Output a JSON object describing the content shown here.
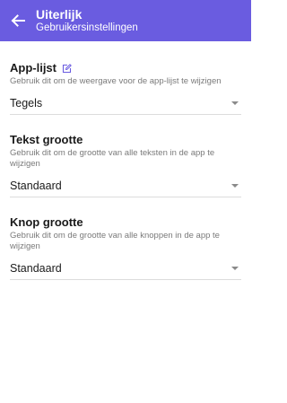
{
  "header": {
    "title": "Uiterlijk",
    "subtitle": "Gebruikersinstellingen",
    "back_icon": "arrow-left-icon",
    "color": "#6a5ce0"
  },
  "settings": [
    {
      "title": "App-lijst",
      "has_edit_icon": true,
      "description": "Gebruik dit om de weergave voor de app-lijst te wijzigen",
      "value": "Tegels"
    },
    {
      "title": "Tekst grootte",
      "has_edit_icon": false,
      "description": "Gebruik dit om de grootte van alle teksten in de app te wijzigen",
      "value": "Standaard"
    },
    {
      "title": "Knop grootte",
      "has_edit_icon": false,
      "description": "Gebruik dit om de grootte van alle knoppen in de app te wijzigen",
      "value": "Standaard"
    }
  ]
}
